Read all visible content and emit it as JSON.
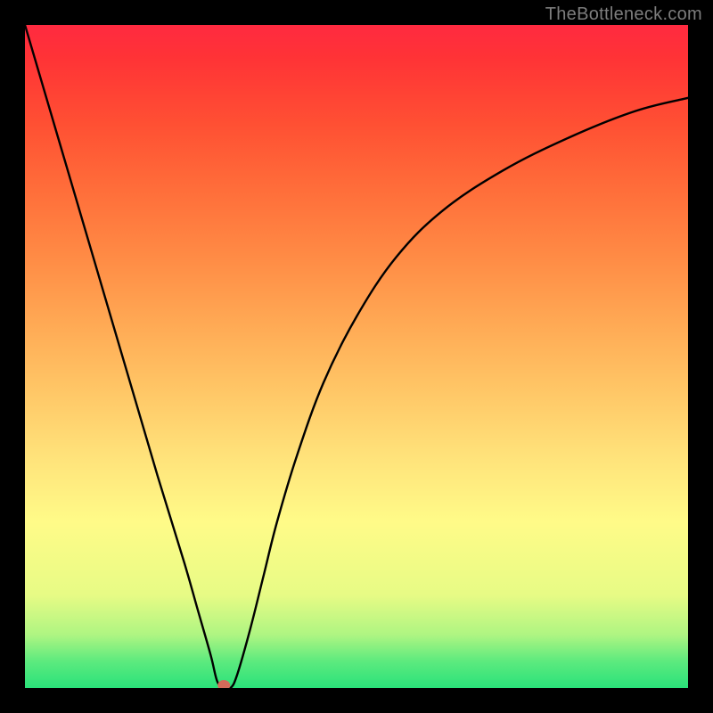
{
  "watermark": "TheBottleneck.com",
  "chart_data": {
    "type": "line",
    "title": "",
    "xlabel": "",
    "ylabel": "",
    "xlim": [
      0,
      100
    ],
    "ylim": [
      0,
      100
    ],
    "grid": false,
    "curve": {
      "name": "bottleneck-curve",
      "x": [
        0,
        5,
        10,
        15,
        20,
        24,
        26,
        28,
        29,
        30,
        31,
        32,
        34,
        36,
        38,
        41,
        45,
        50,
        56,
        63,
        72,
        82,
        92,
        100
      ],
      "y": [
        100,
        83,
        66,
        49,
        32,
        19,
        12,
        5,
        1,
        0,
        0,
        2,
        9,
        17,
        25,
        35,
        46,
        56,
        65,
        72,
        78,
        83,
        87,
        89
      ]
    },
    "marker": {
      "name": "sweet-spot",
      "x": 30,
      "y": 0,
      "color": "#d46b5a",
      "radius_px": 7
    },
    "background_gradient": {
      "top": "#ff2a40",
      "upper_mid": "#ffa954",
      "mid": "#fffb88",
      "lower_mid": "#aef582",
      "bottom": "#2ae27a"
    }
  }
}
